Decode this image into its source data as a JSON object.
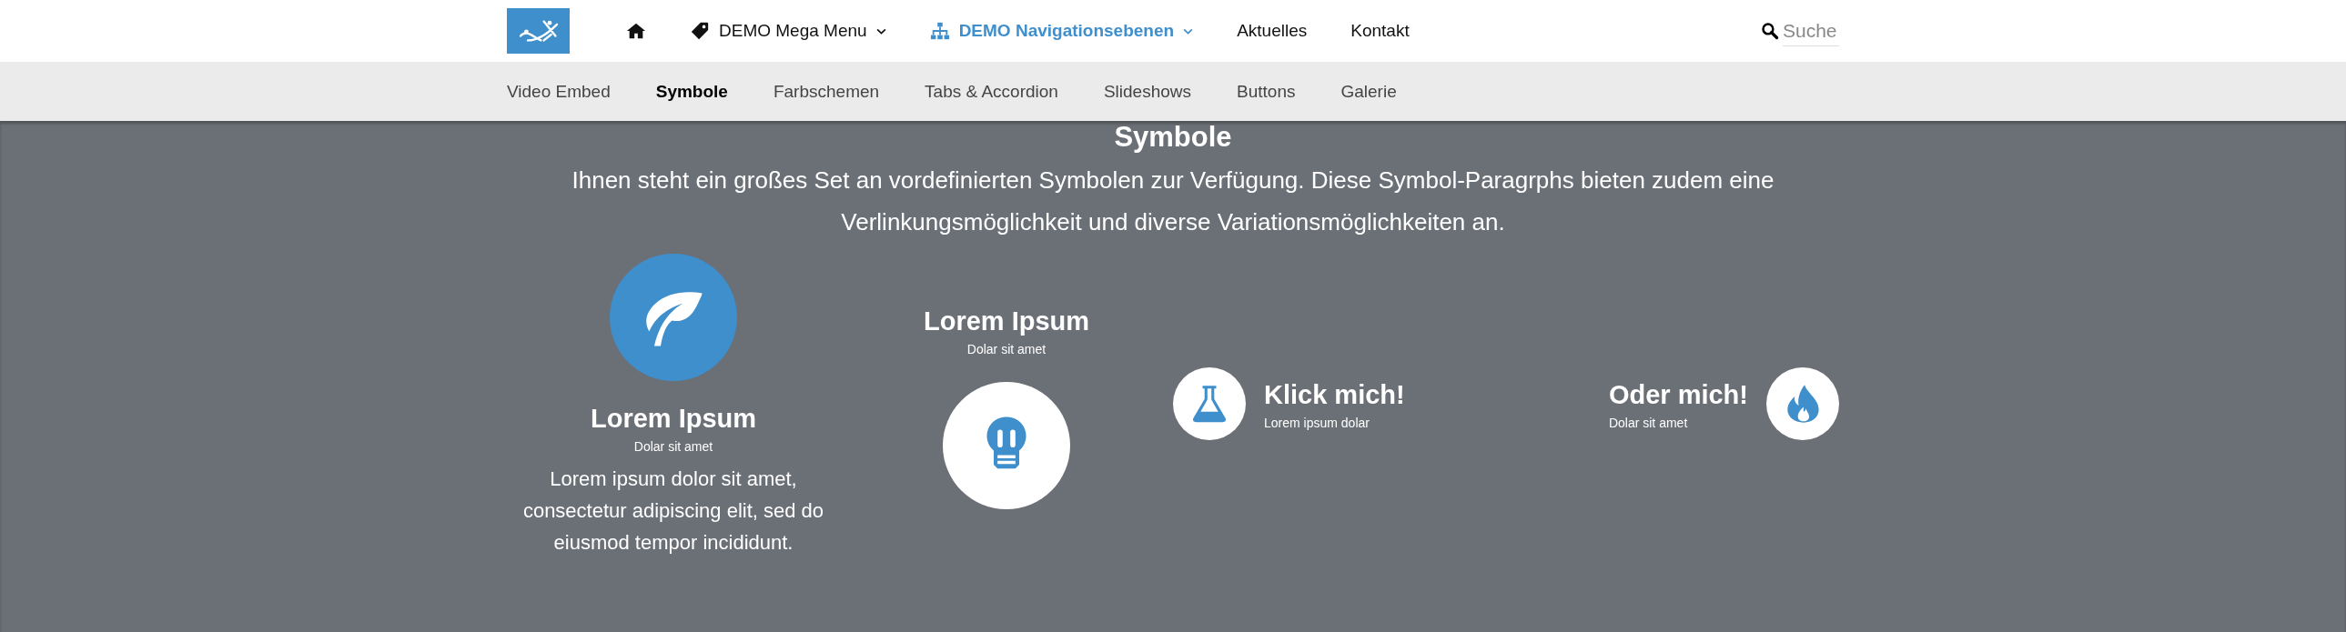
{
  "header": {
    "nav": [
      {
        "kind": "home",
        "selected": false,
        "dropdown": false
      },
      {
        "kind": "tag",
        "label": "DEMO Mega Menu",
        "selected": false,
        "dropdown": true
      },
      {
        "kind": "tree",
        "label": "DEMO Navigationsebenen",
        "selected": true,
        "dropdown": true
      },
      {
        "kind": "plain",
        "label": "Aktuelles",
        "selected": false,
        "dropdown": false
      },
      {
        "kind": "plain",
        "label": "Kontakt",
        "selected": false,
        "dropdown": false
      }
    ],
    "search": {
      "placeholder": "Suche"
    }
  },
  "subnav": [
    {
      "label": "Video Embed",
      "selected": false
    },
    {
      "label": "Symbole",
      "selected": true
    },
    {
      "label": "Farbschemen",
      "selected": false
    },
    {
      "label": "Tabs & Accordion",
      "selected": false
    },
    {
      "label": "Slideshows",
      "selected": false
    },
    {
      "label": "Buttons",
      "selected": false
    },
    {
      "label": "Galerie",
      "selected": false
    }
  ],
  "section": {
    "title": "Symbole",
    "intro": "Ihnen steht ein großes Set an vordefinierten Symbolen zur Verfügung. Diese Symbol-Paragrphs bieten zudem eine Verlinkungsmöglichkeit und diverse Variationsmöglichkeiten an.",
    "symbols": [
      {
        "kind": "top",
        "inverted": false,
        "title": "Lorem Ipsum",
        "subtitle": "Dolar sit amet",
        "text": "Lorem ipsum dolor sit amet, consectetur adipiscing elit, sed do eiusmod tempor incididunt."
      },
      {
        "kind": "bottom",
        "inverted": true,
        "title": "Lorem Ipsum",
        "subtitle": "Dolar sit amet"
      },
      {
        "kind": "left",
        "inverted": true,
        "title": "Klick mich!",
        "subtitle": "Lorem ipsum dolar"
      },
      {
        "kind": "right",
        "inverted": true,
        "title": "Oder mich!",
        "subtitle": "Dolar sit amet"
      }
    ]
  }
}
